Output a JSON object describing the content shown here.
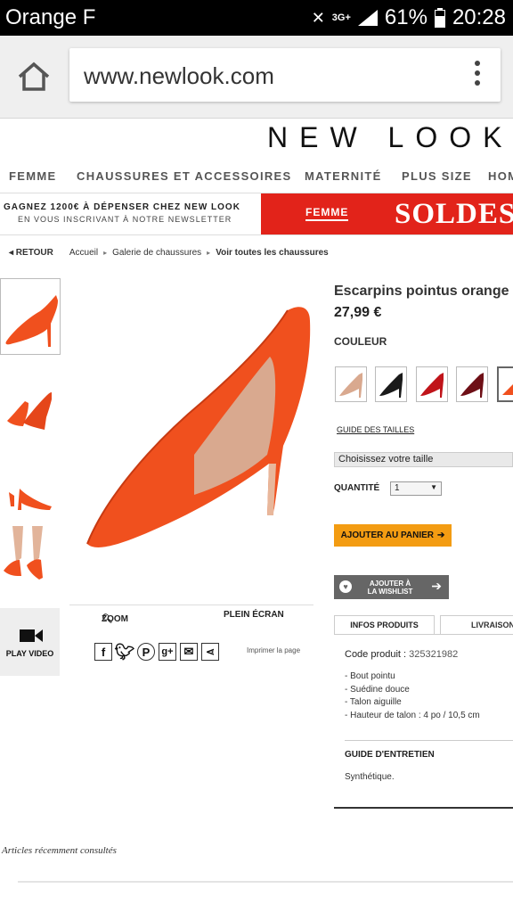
{
  "status_bar": {
    "carrier": "Orange F",
    "network": "3G+",
    "battery": "61%",
    "time": "20:28"
  },
  "browser": {
    "url": "www.newlook.com"
  },
  "site": {
    "logo": "NEW LOOK"
  },
  "nav": {
    "items": [
      "FEMME",
      "CHAUSSURES ET ACCESSOIRES",
      "MATERNITÉ",
      "PLUS SIZE",
      "HOMME"
    ]
  },
  "promo": {
    "line1": "GAGNEZ 1200€ À DÉPENSER CHEZ NEW LOOK",
    "line2": "EN VOUS INSCRIVANT À NOTRE NEWSLETTER",
    "femme": "FEMME",
    "soldes": "SOLDES"
  },
  "breadcrumb": {
    "back": "◂ RETOUR",
    "items": [
      "Accueil",
      "Galerie de chaussures"
    ],
    "current": "Voir toutes les chaussures"
  },
  "gallery": {
    "video_label": "PLAY VIDEO",
    "zoom_label": "ZOOM",
    "fullscreen_label": "PLEIN ÉCRAN",
    "print_label": "Imprimer la page"
  },
  "product": {
    "title": "Escarpins pointus orange",
    "price": "27,99 €",
    "color_label": "COULEUR",
    "swatch_colors": [
      "#d9a98f",
      "#1a1a1a",
      "#c0141a",
      "#6e0f16",
      "#f0501e"
    ],
    "size_guide": "GUIDE DES TAILLES",
    "size_placeholder": "Choisissez votre taille",
    "quantity_label": "QUANTITÉ",
    "quantity_value": "1",
    "add_to_cart": "AJOUTER AU PANIER",
    "wishlist_line1": "AJOUTER À",
    "wishlist_line2": "LA WISHLIST",
    "tabs": [
      "INFOS PRODUITS",
      "LIVRAISON"
    ],
    "code_label": "Code produit :",
    "code_value": "325321982",
    "features": [
      "- Bout pointu",
      "- Suédine douce",
      "- Talon aiguille",
      "- Hauteur de talon : 4 po / 10,5 cm"
    ],
    "care_title": "GUIDE D'ENTRETIEN",
    "care_text": "Synthétique."
  },
  "recent": {
    "label": "Articles récemment consultés"
  },
  "colors": {
    "shoe": "#f0501e",
    "sale_red": "#e2231a",
    "cart_orange": "#f39c12"
  }
}
